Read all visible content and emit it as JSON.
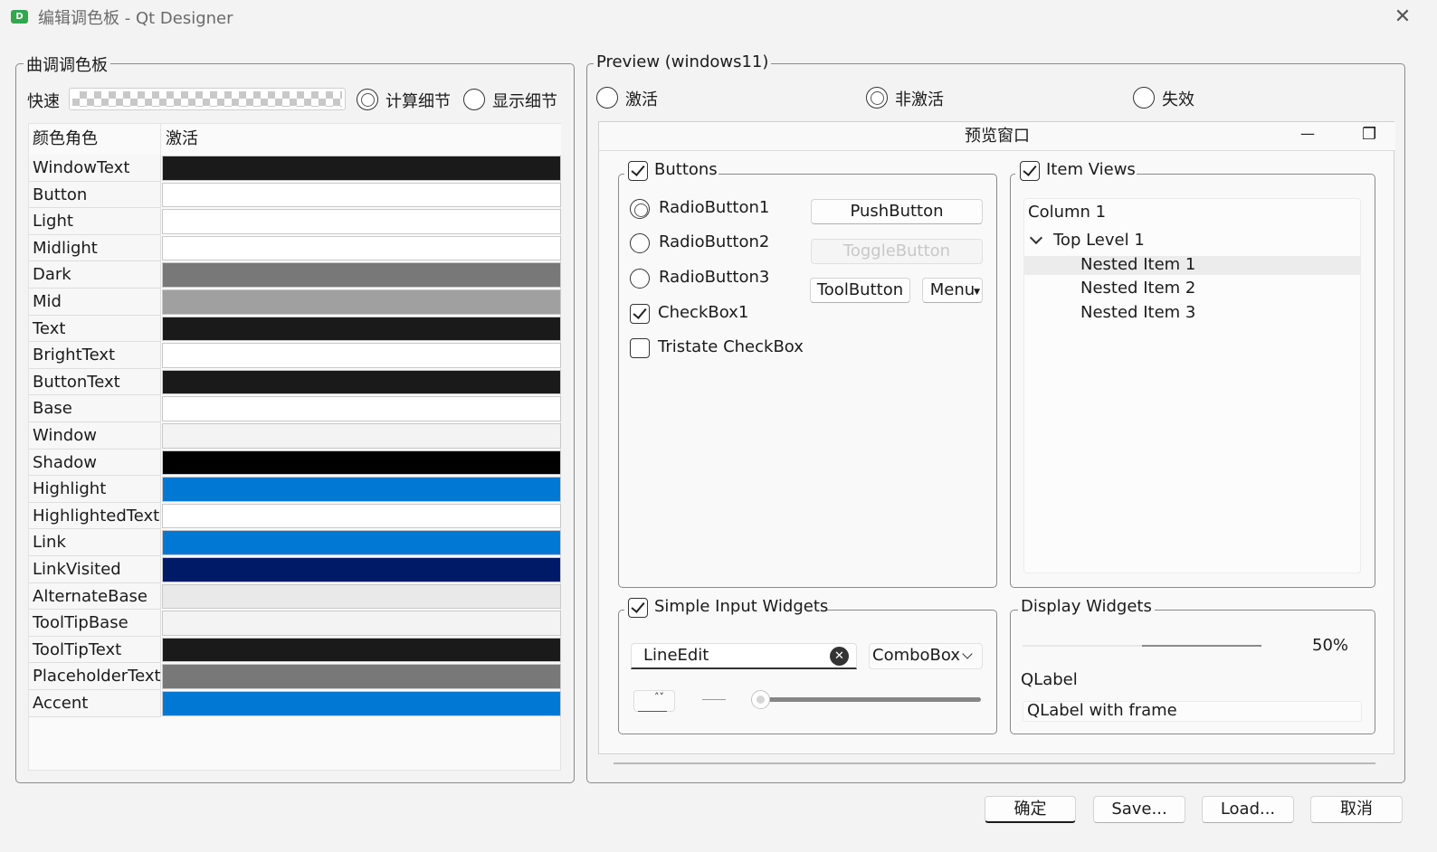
{
  "window": {
    "title": "编辑调色板 - Qt Designer",
    "app_icon_text": "D",
    "close_glyph": "✕"
  },
  "tune_group": {
    "title": "曲调调色板",
    "quick_label": "快速",
    "radio_compute": "计算细节",
    "radio_show": "显示细节",
    "compute_selected": true,
    "show_selected": false
  },
  "table": {
    "headers": [
      "颜色角色",
      "激活"
    ],
    "rows": [
      {
        "name": "WindowText",
        "color": "#1a1a1a"
      },
      {
        "name": "Button",
        "color": "#ffffff"
      },
      {
        "name": "Light",
        "color": "#ffffff"
      },
      {
        "name": "Midlight",
        "color": "#ffffff"
      },
      {
        "name": "Dark",
        "color": "#787878"
      },
      {
        "name": "Mid",
        "color": "#a0a0a0"
      },
      {
        "name": "Text",
        "color": "#1a1a1a"
      },
      {
        "name": "BrightText",
        "color": "#ffffff"
      },
      {
        "name": "ButtonText",
        "color": "#1a1a1a"
      },
      {
        "name": "Base",
        "color": "#ffffff"
      },
      {
        "name": "Window",
        "color": "#f3f3f3"
      },
      {
        "name": "Shadow",
        "color": "#000000"
      },
      {
        "name": "Highlight",
        "color": "#0078d4"
      },
      {
        "name": "HighlightedText",
        "color": "#ffffff"
      },
      {
        "name": "Link",
        "color": "#0078d4"
      },
      {
        "name": "LinkVisited",
        "color": "#001a68"
      },
      {
        "name": "AlternateBase",
        "color": "#e9e9e9"
      },
      {
        "name": "ToolTipBase",
        "color": "#f3f3f3"
      },
      {
        "name": "ToolTipText",
        "color": "#1a1a1a"
      },
      {
        "name": "PlaceholderText",
        "color": "#787878"
      },
      {
        "name": "Accent",
        "color": "#0078d4"
      }
    ]
  },
  "preview": {
    "title": "Preview (windows11)",
    "modes": [
      "激活",
      "非激活",
      "失效"
    ],
    "selected_mode": "非激活",
    "window_title": "预览窗口",
    "minimize_glyph": "—",
    "restore_glyph": "❐",
    "buttons_group": {
      "title": "Buttons",
      "radio1": "RadioButton1",
      "radio2": "RadioButton2",
      "radio3": "RadioButton3",
      "checkbox1": "CheckBox1",
      "tristate": "Tristate CheckBox",
      "push": "PushButton",
      "toggle": "ToggleButton",
      "tool": "ToolButton",
      "menu": "Menu"
    },
    "item_views": {
      "title": "Item Views",
      "column": "Column 1",
      "top_level": "Top Level 1",
      "items": [
        "Nested Item 1",
        "Nested Item 2",
        "Nested Item 3"
      ]
    },
    "input_widgets": {
      "title": "Simple Input Widgets",
      "lineedit": "LineEdit",
      "combobox": "ComboBox",
      "slider_value": 0
    },
    "display_widgets": {
      "title": "Display Widgets",
      "progress_text": "50%",
      "progress_value": 0.5,
      "label": "QLabel",
      "label_frame": "QLabel with frame"
    }
  },
  "footer": {
    "ok": "确定",
    "save": "Save...",
    "load": "Load...",
    "cancel": "取消"
  }
}
